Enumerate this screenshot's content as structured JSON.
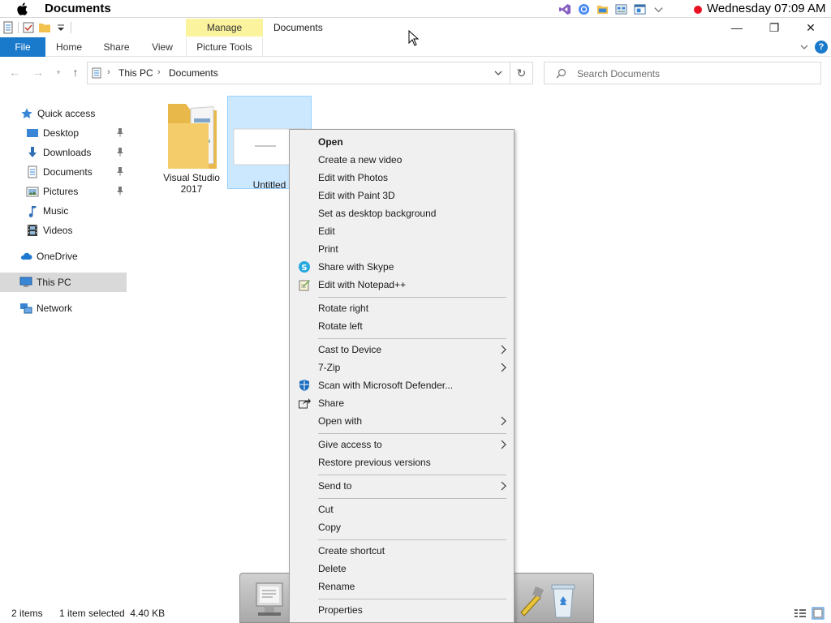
{
  "menubar": {
    "app_name": "Documents",
    "clock": "Wednesday 07:09 AM",
    "tray_icons": [
      "visual-studio-icon",
      "chrome-icon",
      "file-explorer-icon",
      "control-panel-icon",
      "app-window-icon",
      "chevron-down-icon"
    ]
  },
  "window": {
    "title": "Documents",
    "context_tab_header": "Manage",
    "controls": {
      "minimize": "—",
      "maximize": "❐",
      "close": "✕"
    }
  },
  "ribbon": {
    "tabs": [
      "File",
      "Home",
      "Share",
      "View",
      "Picture Tools"
    ],
    "help": "?"
  },
  "address": {
    "crumbs": [
      "This PC",
      "Documents"
    ],
    "search_placeholder": "Search Documents"
  },
  "nav_pane": {
    "quick_access": "Quick access",
    "pinned": [
      "Desktop",
      "Downloads",
      "Documents",
      "Pictures"
    ],
    "unpinned": [
      "Music",
      "Videos"
    ],
    "onedrive": "OneDrive",
    "this_pc": "This PC",
    "network": "Network"
  },
  "files": [
    {
      "name": "Visual Studio 2017",
      "name_line1": "Visual Studio",
      "name_line2": "2017",
      "kind": "folder"
    },
    {
      "name": "Untitled",
      "kind": "image",
      "selected": true
    }
  ],
  "status": {
    "count": "2 items",
    "selection": "1 item selected  4.40 KB"
  },
  "context_menu": {
    "group1": [
      {
        "label": "Open",
        "bold": true
      },
      {
        "label": "Create a new video"
      },
      {
        "label": "Edit with Photos"
      },
      {
        "label": "Edit with Paint 3D"
      },
      {
        "label": "Set as desktop background"
      },
      {
        "label": "Edit"
      },
      {
        "label": "Print"
      },
      {
        "label": "Share with Skype",
        "icon": "skype-icon"
      },
      {
        "label": "Edit with Notepad++",
        "icon": "notepad-plus-plus-icon"
      }
    ],
    "group2": [
      {
        "label": "Rotate right"
      },
      {
        "label": "Rotate left"
      }
    ],
    "group3": [
      {
        "label": "Cast to Device",
        "submenu": true
      },
      {
        "label": "7-Zip",
        "submenu": true
      },
      {
        "label": "Scan with Microsoft Defender...",
        "icon": "defender-shield-icon"
      },
      {
        "label": "Share",
        "icon": "share-icon"
      },
      {
        "label": "Open with",
        "submenu": true
      }
    ],
    "group4": [
      {
        "label": "Give access to",
        "submenu": true
      },
      {
        "label": "Restore previous versions"
      }
    ],
    "group5": [
      {
        "label": "Send to",
        "submenu": true
      }
    ],
    "group6": [
      {
        "label": "Cut"
      },
      {
        "label": "Copy"
      }
    ],
    "group7": [
      {
        "label": "Create shortcut"
      },
      {
        "label": "Delete"
      },
      {
        "label": "Rename"
      }
    ],
    "group8": [
      {
        "label": "Properties"
      }
    ]
  },
  "colors": {
    "file_tab": "#1979ca",
    "manage_tab": "#fbf39e",
    "selection": "#cce8ff",
    "menu_bg": "#f0f0f0"
  }
}
